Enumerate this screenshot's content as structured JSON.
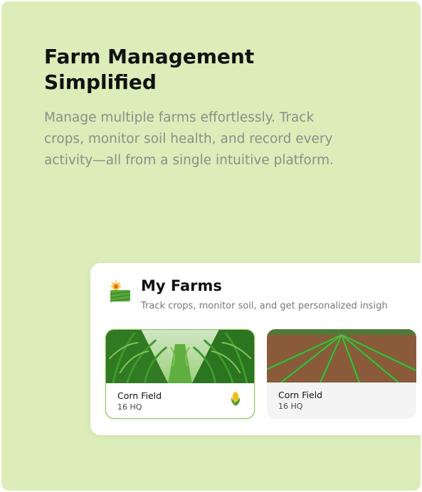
{
  "hero": {
    "title": "Farm Management Simplified",
    "description": "Manage multiple farms effortlessly. Track crops, monitor soil health, and record every activity—all from a single intuitive platform."
  },
  "farms_panel": {
    "header_icon": "farm-field-icon",
    "title": "My Farms",
    "subtitle": "Track crops, monitor soil, and get personalized insigh",
    "farms": [
      {
        "name": "Corn Field",
        "size": "16 HQ",
        "selected": true,
        "crop_icon": "corn-icon"
      },
      {
        "name": "Corn Field",
        "size": "16 HQ",
        "selected": false
      }
    ]
  },
  "colors": {
    "panel_background": "#dcedb9",
    "selected_border": "#8cc04a",
    "title_text": "#111111",
    "muted_text": "#8a8f88"
  }
}
